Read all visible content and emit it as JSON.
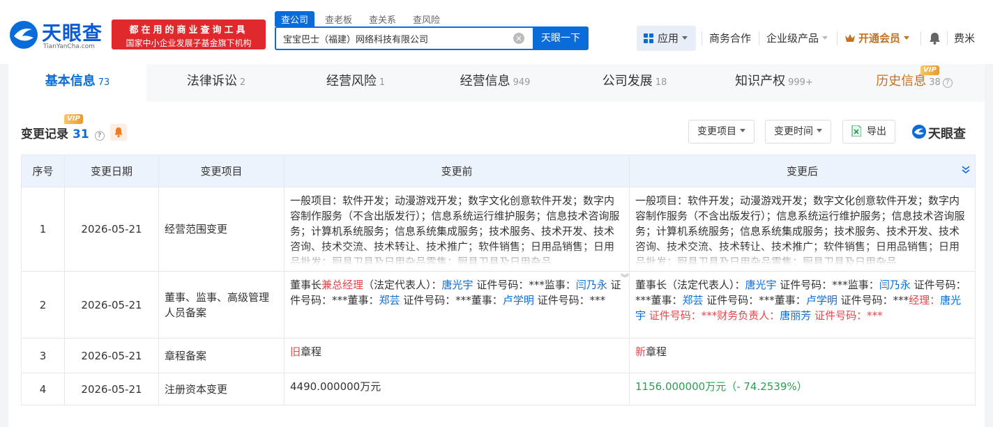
{
  "header": {
    "logo_text": "天眼查",
    "logo_sub": "TianYanCha.com",
    "promo_line1": "都在用的商业查询工具",
    "promo_line2": "国家中小企业发展子基金旗下机构",
    "search_tabs": [
      "查公司",
      "查老板",
      "查关系",
      "查风险"
    ],
    "search_value": "宝宝巴士（福建）网络科技有限公司",
    "search_button": "天眼一下",
    "nav": {
      "apps": "应用",
      "business": "商务合作",
      "enterprise": "企业级产品",
      "vip": "开通会员",
      "user": "费米"
    }
  },
  "tabs": [
    {
      "label": "基本信息",
      "count": "73"
    },
    {
      "label": "法律诉讼",
      "count": "2"
    },
    {
      "label": "经营风险",
      "count": "1"
    },
    {
      "label": "经营信息",
      "count": "949"
    },
    {
      "label": "公司发展",
      "count": "18"
    },
    {
      "label": "知识产权",
      "count": "999+"
    },
    {
      "label": "历史信息",
      "count": "38"
    }
  ],
  "vip_label": "VIP",
  "section": {
    "title": "变更记录",
    "count": "31",
    "filter_item": "变更项目",
    "filter_time": "变更时间",
    "export": "导出",
    "watermark": "天眼查"
  },
  "table": {
    "headers": [
      "序号",
      "变更日期",
      "变更项目",
      "变更前",
      "变更后"
    ],
    "rows": [
      {
        "no": "1",
        "date": "2026-05-21",
        "item": "经营范围变更",
        "before": "一般项目：软件开发；动漫游戏开发；数字文化创意软件开发；数字内容制作服务（不含出版发行）；信息系统运行维护服务；信息技术咨询服务；计算机系统服务；信息系统集成服务；技术服务、技术开发、技术咨询、技术交流、技术转让、技术推广；软件销售；日用品销售；日用品批发；厨具卫具及日用杂品零售；厨具卫具及日用杂品",
        "after": "一般项目：软件开发；动漫游戏开发；数字文化创意软件开发；数字内容制作服务（不含出版发行）；信息系统运行维护服务；信息技术咨询服务；计算机系统服务；信息系统集成服务；技术服务、技术开发、技术咨询、技术交流、技术转让、技术推广；软件销售；日用品销售；日用品批发；厨具卫具及日用杂品零售；厨具卫具及日用杂品"
      },
      {
        "no": "2",
        "date": "2026-05-21",
        "item": "董事、监事、高级管理人员备案",
        "before": {
          "t1": "董事长",
          "t2": "兼总经理",
          "t3": "（法定代表人）：",
          "p1": "唐光宇",
          "t4": " 证件号码：***监事：",
          "p2": "闫乃永",
          "t5": " 证件号码：***董事：",
          "p3": "郑芸",
          "t6": " 证件号码：***董事：",
          "p4": "卢学明",
          "t7": " 证件号码：***"
        },
        "after": {
          "t1": "董事长（法定代表人）：",
          "p1": "唐光宇",
          "t2": " 证件号码：***监事：",
          "p2": "闫乃永",
          "t3": " 证件号码：***董事：",
          "p3": "郑芸",
          "t4": " 证件号码：***董事：",
          "p4": "卢学明",
          "t5": " 证件号码：***",
          "t6": "经理：",
          "p5": "唐光宇",
          "t7": " 证件号码：***财务负责人：",
          "p6": "唐丽芳",
          "t8": " 证件号码：***"
        }
      },
      {
        "no": "3",
        "date": "2026-05-21",
        "item": "章程备案",
        "before_mark": "旧",
        "before": "章程",
        "after_mark": "新",
        "after": "章程"
      },
      {
        "no": "4",
        "date": "2026-05-21",
        "item": "注册资本变更",
        "before": "4490.000000万元",
        "after": "1156.000000万元（- 74.2539%）"
      }
    ]
  },
  "colors": {
    "brand_blue": "#0a6cd8",
    "promo_red": "#e0292d",
    "vip_orange": "#c5711f",
    "change_red": "#e5454b",
    "change_green": "#27a150"
  }
}
